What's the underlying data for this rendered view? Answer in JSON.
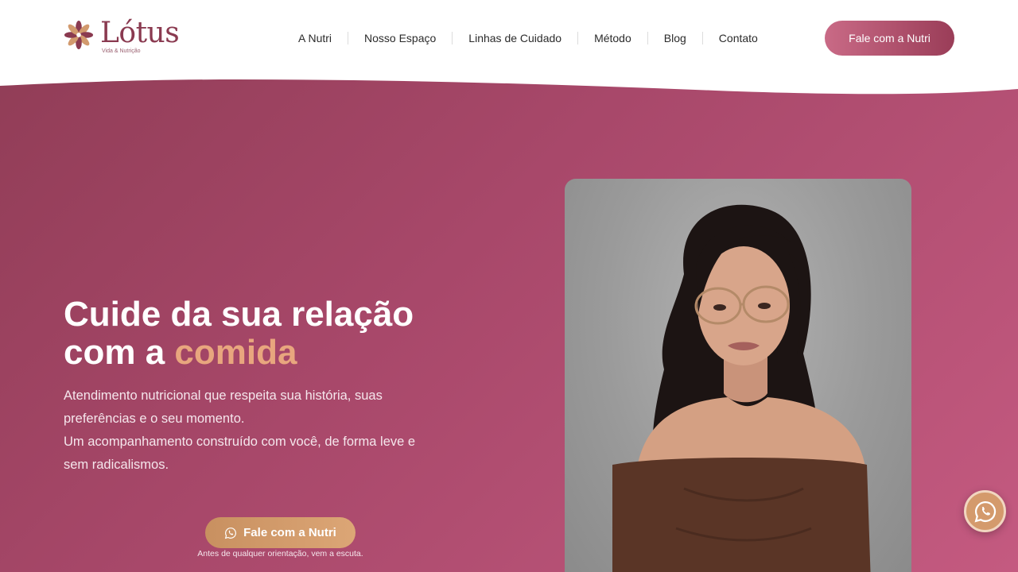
{
  "brand": {
    "name": "Lótus",
    "tagline": "Vida & Nutrição",
    "primary_color": "#9a3d58",
    "accent_color": "#e8a67e"
  },
  "nav": {
    "items": [
      {
        "label": "A Nutri"
      },
      {
        "label": "Nosso Espaço"
      },
      {
        "label": "Linhas de Cuidado"
      },
      {
        "label": "Método"
      },
      {
        "label": "Blog"
      },
      {
        "label": "Contato"
      }
    ]
  },
  "header": {
    "cta_label": "Fale com a Nutri"
  },
  "hero": {
    "title_line1": "Cuide da sua relação",
    "title_line2_prefix": "com a ",
    "title_line2_accent": "comida",
    "description_1": "Atendimento nutricional que respeita sua história, suas preferências e o seu momento.",
    "description_2": "Um acompanhamento construído com você, de forma leve e sem radicalismos.",
    "cta_label": "Fale com a Nutri",
    "cta_icon": "whatsapp-icon",
    "cta_note": "Antes de qualquer orientação, vem a escuta."
  },
  "floating": {
    "icon": "whatsapp-icon"
  }
}
